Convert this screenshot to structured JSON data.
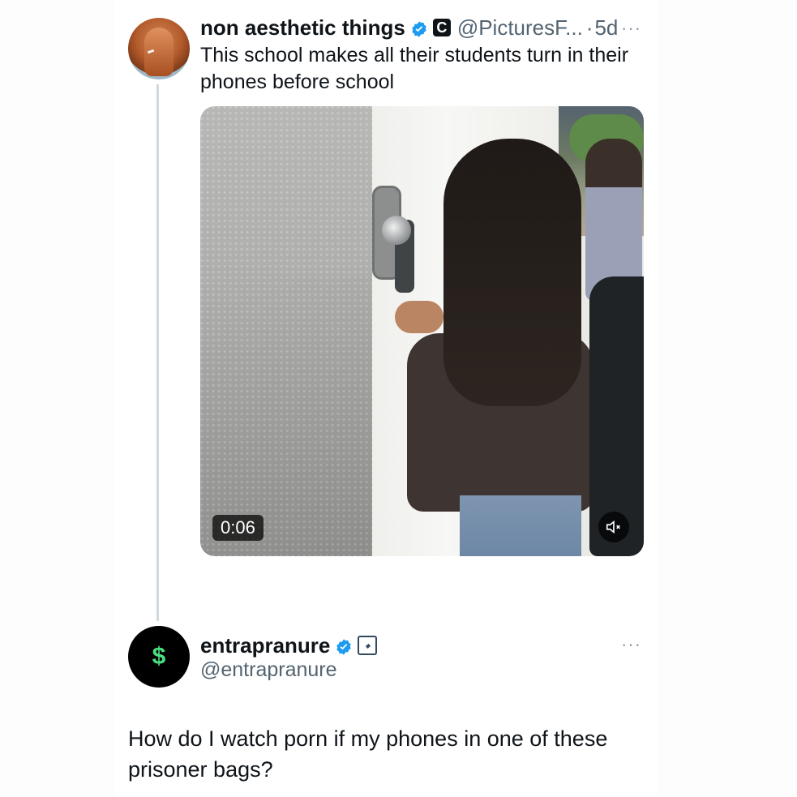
{
  "tweet1": {
    "author_name": "non aesthetic things",
    "affiliate_badge_letter": "C",
    "handle": "@PicturesF...",
    "separator": "·",
    "time": "5d",
    "more": "···",
    "text": "This school makes all their students turn in their phones before school",
    "media": {
      "video_time": "0:06",
      "mute_icon": "speaker-muted-icon"
    }
  },
  "tweet2": {
    "author_name": "entrapranure",
    "avatar_symbol": "$",
    "handle": "@entrapranure",
    "more": "···",
    "text": "How do I watch porn if my phones in one of these prisoner bags?"
  },
  "colors": {
    "verified_blue": "#1d9bf0",
    "text_primary": "#0f1419",
    "text_secondary": "#536471",
    "thread_line": "#cfd9de",
    "dollar_green": "#4ade80"
  }
}
